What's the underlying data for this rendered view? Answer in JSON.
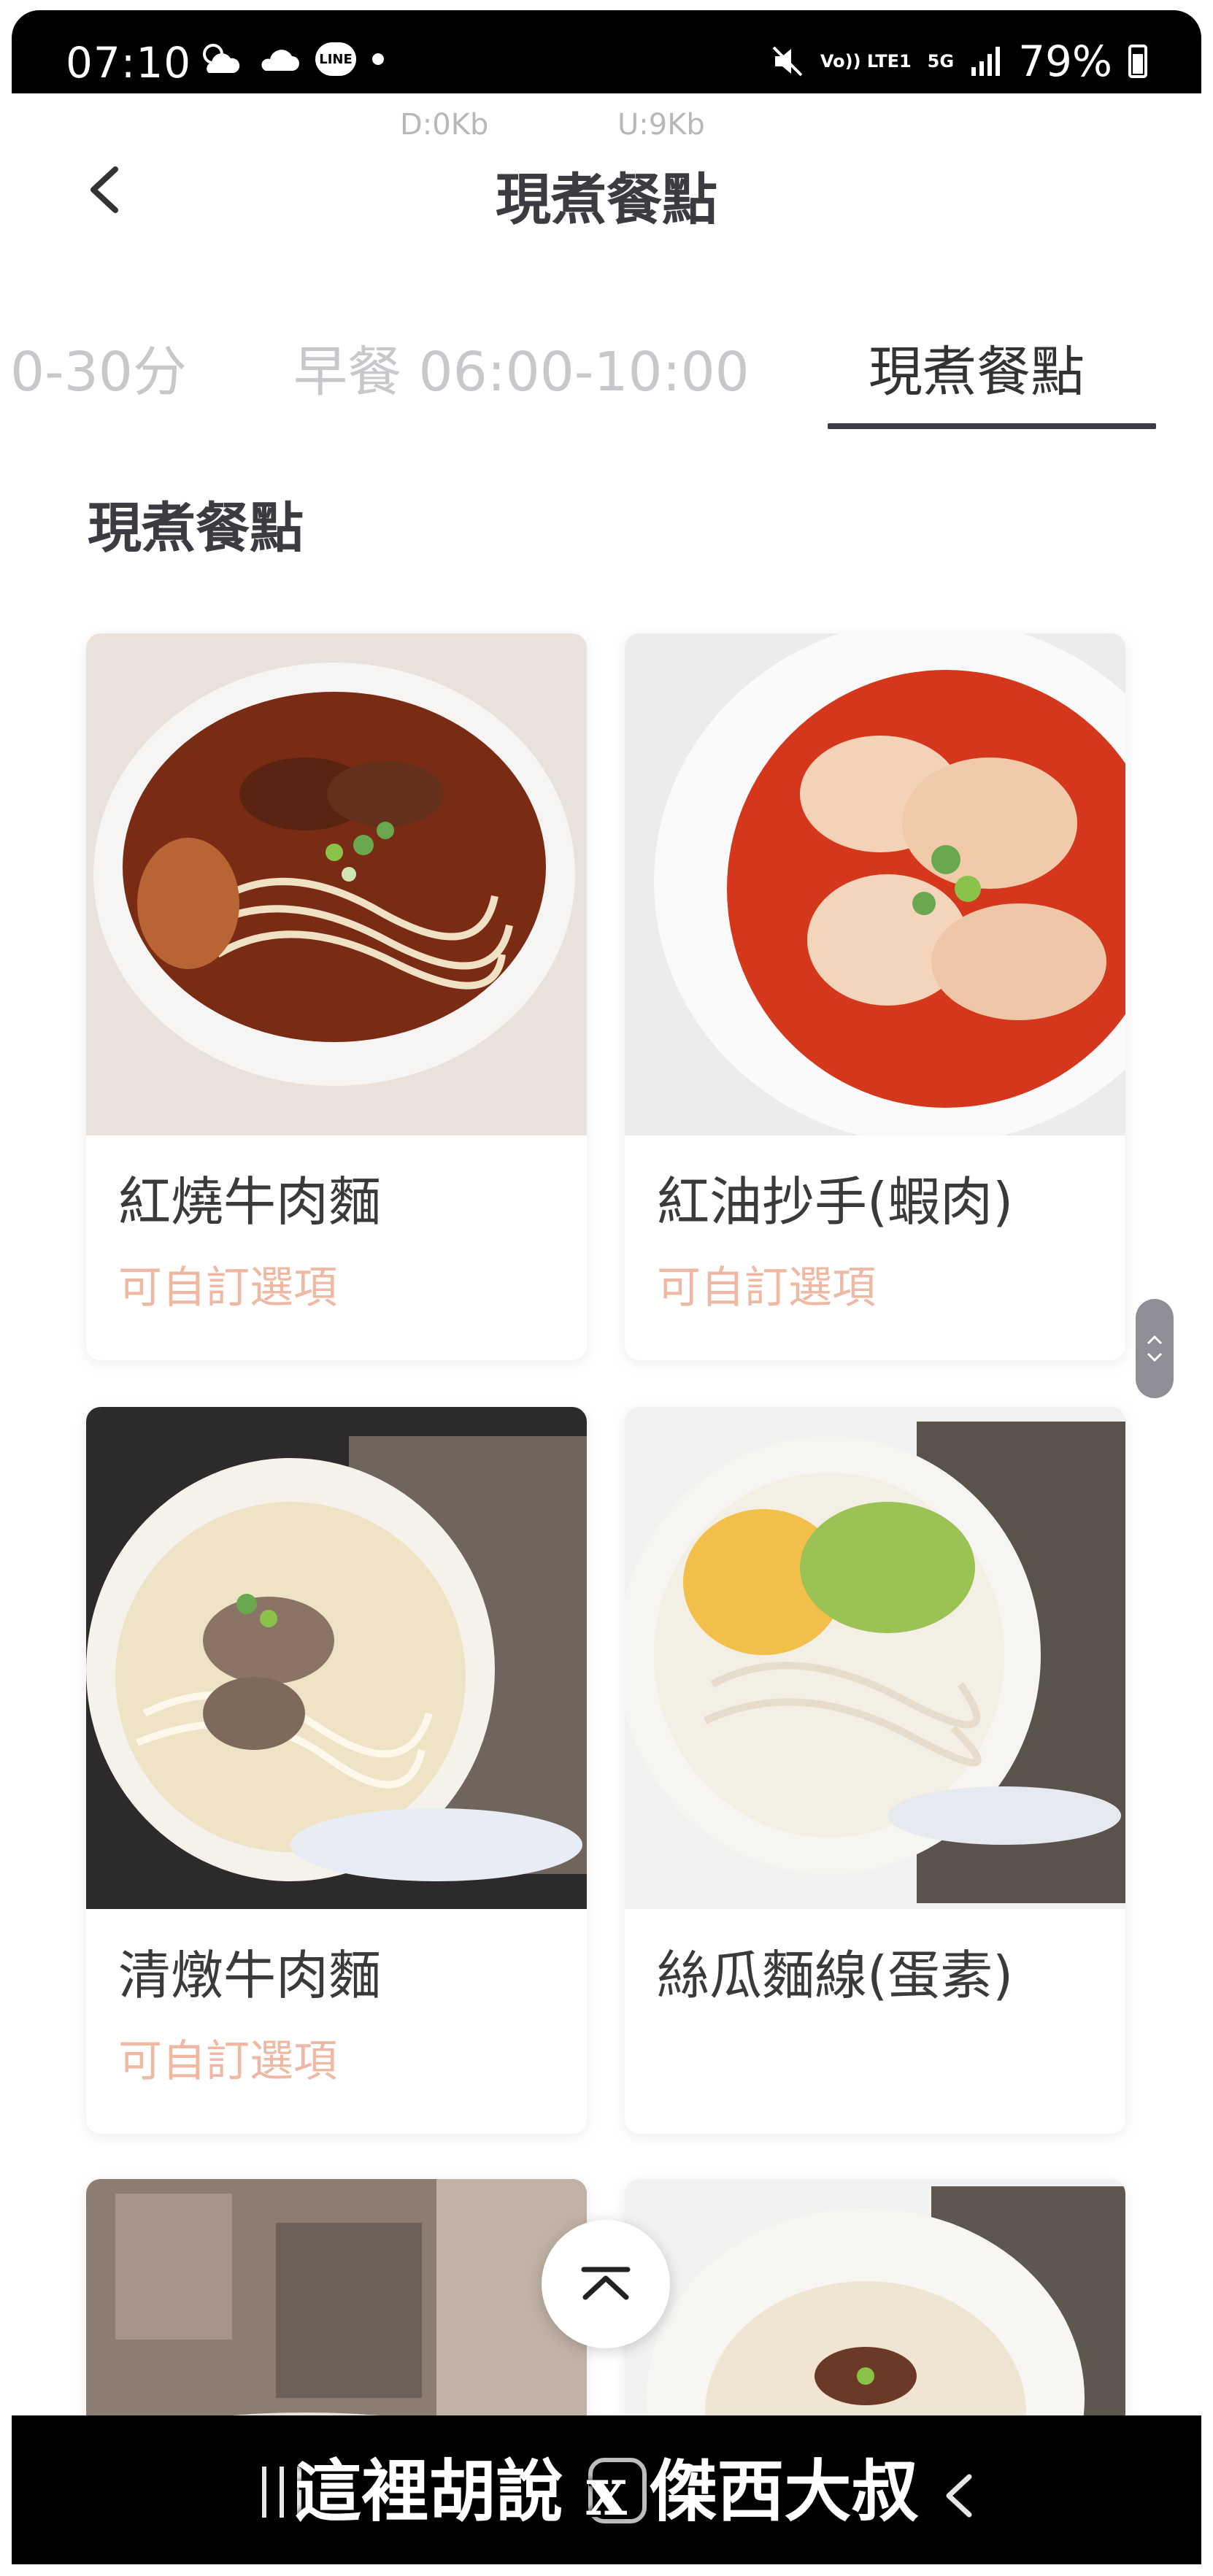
{
  "status_bar": {
    "time": "07:10",
    "line_badge": "LINE",
    "volte_label": "Vo)) LTE1",
    "network": "5G",
    "battery": "79%"
  },
  "net_speed": {
    "download": "D:0Kb",
    "upload": "U:9Kb"
  },
  "header": {
    "title": "現煮餐點"
  },
  "tabs": [
    {
      "label": "0-30分"
    },
    {
      "label": "早餐 06:00-10:00"
    },
    {
      "label": "現煮餐點",
      "active": true
    }
  ],
  "section": {
    "title": "現煮餐點"
  },
  "menu_items": [
    {
      "name": "紅燒牛肉麵",
      "subtitle": "可自訂選項"
    },
    {
      "name": "紅油抄手(蝦肉)",
      "subtitle": "可自訂選項"
    },
    {
      "name": "清燉牛肉麵",
      "subtitle": "可自訂選項"
    },
    {
      "name": "絲瓜麵線(蛋素)",
      "subtitle": ""
    }
  ],
  "watermark": "這裡胡說 x 傑西大叔",
  "colors": {
    "accent_text": "#eeb8a3",
    "title": "#3b3b42",
    "tab_inactive": "#c8c8cc"
  },
  "icons": [
    "back-arrow-icon",
    "scroll-to-top-icon",
    "nav-recents-icon",
    "nav-home-icon",
    "nav-back-icon"
  ]
}
